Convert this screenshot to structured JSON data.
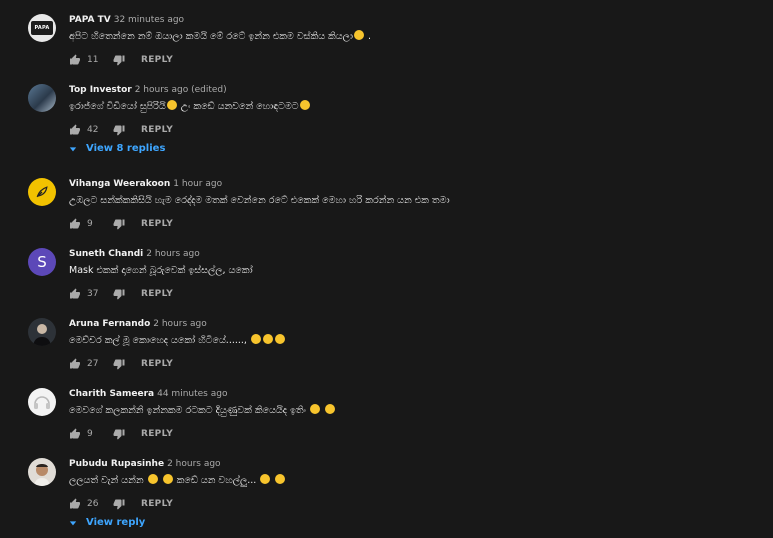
{
  "comments": [
    {
      "author": "PAPA TV",
      "time": "32 minutes ago",
      "text": "අපිට හිතෙන්නෙ නම් ඔයාලා කමයි මේ රටේ ඉන්න එකම වස්කිය කියලා",
      "text_suffix": " .",
      "emojis": 1,
      "likes": "11",
      "reply": "REPLY",
      "avatar_text": "PAPA",
      "view_replies": ""
    },
    {
      "author": "Top Investor",
      "time": "2 hours ago (edited)",
      "text": "ඉරාජ්ගේ විඩියෝ සුපිරියි",
      "text_mid": " උං කඩේ යනවනේ හොඳටමට",
      "emojis": 2,
      "likes": "42",
      "reply": "REPLY",
      "view_replies": "View 8 replies"
    },
    {
      "author": "Vihanga Weerakoon",
      "time": "1 hour ago",
      "text": "උඹලට සන්ක්කකිසියි හැම රෙද්දම මතක් වෙන්නෙ රටේ එකෙක් මෙහා හරි කරන්න යන එක තමා",
      "likes": "9",
      "reply": "REPLY",
      "view_replies": ""
    },
    {
      "author": "Suneth Chandi",
      "time": "2 hours ago",
      "text": "Mask එකක් දාගෙන් බූරුවෙක් ඉස්සල්ල, යකෝ",
      "likes": "37",
      "reply": "REPLY",
      "avatar_text": "S",
      "view_replies": ""
    },
    {
      "author": "Aruna Fernando",
      "time": "2 hours ago",
      "text": "මෙච්චර කල් මූ කොහෙද යකෝ හිටියේ......,",
      "emojis": 3,
      "likes": "27",
      "reply": "REPLY",
      "view_replies": ""
    },
    {
      "author": "Charith Sameera",
      "time": "44 minutes ago",
      "text": "මෙවගේ කලකන්නි ඉන්නකම රටකට දියුණුවක් කියෙයිද ඉතිං",
      "emojis": 2,
      "likes": "9",
      "reply": "REPLY",
      "view_replies": ""
    },
    {
      "author": "Pubudu Rupasinhe",
      "time": "2 hours ago",
      "text": "ලලයත් වැන් යන්න",
      "text_mid": " කඩේ යන වහල්ලු...",
      "emojis": 2,
      "emojis_end": 2,
      "likes": "26",
      "reply": "REPLY",
      "view_replies": "View reply"
    }
  ],
  "colors": {
    "background": "#181818",
    "link": "#3ea6ff",
    "secondary": "#aaaaaa"
  }
}
